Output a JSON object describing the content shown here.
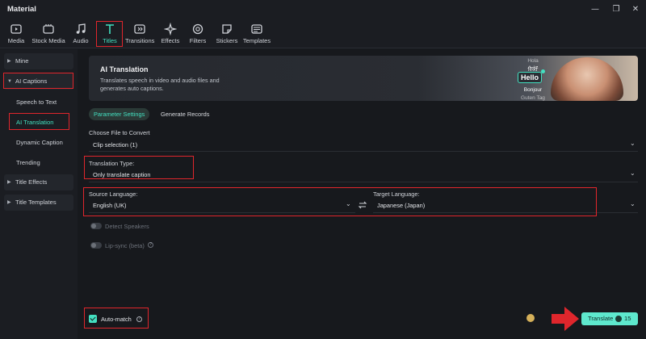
{
  "window": {
    "title": "Material",
    "controls": {
      "minimize": "—",
      "restore": "❐",
      "close": "✕"
    }
  },
  "toolbar": {
    "items": [
      {
        "label": "Media",
        "icon": "media-icon"
      },
      {
        "label": "Stock Media",
        "icon": "stock-media-icon"
      },
      {
        "label": "Audio",
        "icon": "music-note-icon"
      },
      {
        "label": "Titles",
        "icon": "text-t-icon",
        "active": true
      },
      {
        "label": "Transitions",
        "icon": "transitions-icon"
      },
      {
        "label": "Effects",
        "icon": "effects-sparkle-icon"
      },
      {
        "label": "Filters",
        "icon": "filters-icon"
      },
      {
        "label": "Stickers",
        "icon": "sticker-icon"
      },
      {
        "label": "Templates",
        "icon": "templates-icon"
      }
    ]
  },
  "sidebar": {
    "mine": "Mine",
    "ai_captions": "AI Captions",
    "speech_to_text": "Speech to Text",
    "ai_translation": "AI Translation",
    "dynamic_caption": "Dynamic Caption",
    "trending": "Trending",
    "title_effects": "Title Effects",
    "title_templates": "Title Templates"
  },
  "banner": {
    "title": "AI Translation",
    "description": "Translates speech in video and audio files and generates auto captions.",
    "words": [
      "Hola",
      "你好",
      "Hello",
      "Bonjour",
      "Guten Tag"
    ]
  },
  "tabs": {
    "parameter_settings": "Parameter Settings",
    "generate_records": "Generate Records"
  },
  "form": {
    "choose_file_label": "Choose File to Convert",
    "choose_file_value": "Clip selection (1)",
    "translation_type_label": "Translation Type:",
    "translation_type_value": "Only translate caption",
    "source_language_label": "Source Language:",
    "source_language_value": "English (UK)",
    "target_language_label": "Target Language:",
    "target_language_value": "Japanese (Japan)",
    "detect_speakers": "Detect Speakers",
    "lip_sync": "Lip-sync (beta)",
    "auto_match": "Auto-match"
  },
  "actions": {
    "translate_label": "Translate",
    "translate_cost": "15"
  },
  "colors": {
    "accent": "#43e0c0",
    "button": "#5ee8cd",
    "highlight": "#e0262c",
    "background": "#17191d"
  }
}
